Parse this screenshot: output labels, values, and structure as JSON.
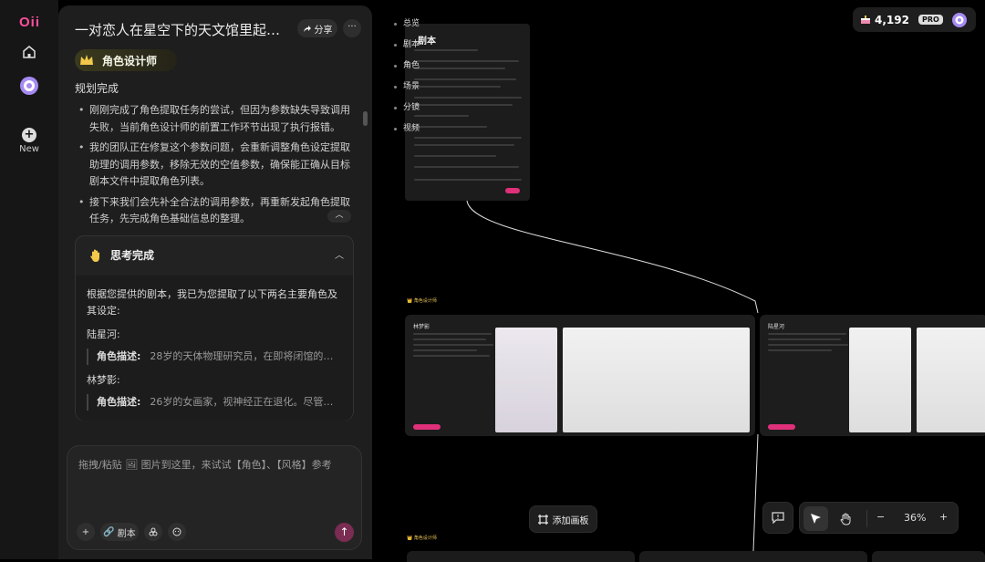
{
  "rail": {
    "logo": "Oii",
    "new_label": "New"
  },
  "chat": {
    "title": "一对恋人在星空下的天文馆里起舞...",
    "share_label": "分享",
    "more_label": "···",
    "role_tag": "角色设计师",
    "plan_status": "规划完成",
    "bullets": [
      "刚刚完成了角色提取任务的尝试，但因为参数缺失导致调用失败，当前角色设计师的前置工作环节出现了执行报错。",
      "我的团队正在修复这个参数问题，会重新调整角色设定提取助理的调用参数，移除无效的空值参数，确保能正确从目标剧本文件中提取角色列表。",
      "接下来我们会先补全合法的调用参数，再重新发起角色提取任务，先完成角色基础信息的整理。"
    ],
    "thinking": {
      "title": "思考完成",
      "intro": "根据您提供的剧本，我已为您提取了以下两名主要角色及其设定:",
      "characters": [
        {
          "name": "陆星河:",
          "desc_label": "角色描述:",
          "desc": "28岁的天体物理研究员，在即将闭馆的星..."
        },
        {
          "name": "林梦影:",
          "desc_label": "角色描述:",
          "desc": "26岁的女画家，视神经正在退化。尽管眼..."
        }
      ]
    },
    "composer": {
      "placeholder": "拖拽/粘贴 🖼 图片到这里，来试试【角色】、【风格】参考",
      "script_tool": "剧本"
    }
  },
  "canvas": {
    "outline": [
      "总览",
      "剧本",
      "角色",
      "场景",
      "分镜",
      "视频"
    ],
    "script_card_title": "剧本",
    "section_label": "角色设计师",
    "characters": [
      {
        "name": "林梦影"
      },
      {
        "name": "陆星河"
      }
    ],
    "credits": "4,192",
    "pro_badge": "PRO",
    "add_panel_label": "添加画板",
    "zoom": "36%"
  },
  "colors": {
    "accent_pink": "#e0307a",
    "role_gold": "#e8c458",
    "bg": "#000000",
    "panel": "#1e1e1e"
  }
}
